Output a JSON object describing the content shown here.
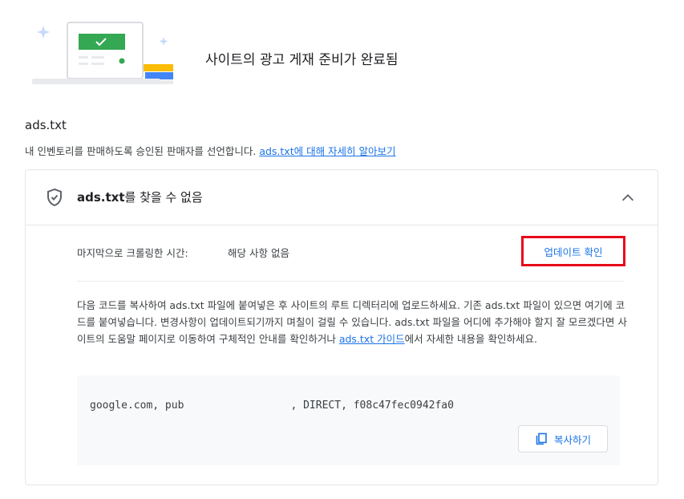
{
  "hero": {
    "title": "사이트의 광고 게재 준비가 완료됨"
  },
  "section": {
    "title": "ads.txt",
    "description": "내 인벤토리를 판매하도록 승인된 판매자를 선언합니다.",
    "learn_more_link": "ads.txt에 대해 자세히 알아보기"
  },
  "card": {
    "status_name": "ads.txt",
    "status_suffix": "를 찾을 수 없음",
    "crawl_label": "마지막으로 크롤링한 시간:",
    "crawl_value": "해당 사항 없음",
    "check_update_label": "업데이트 확인",
    "instructions_text": "다음 코드를 복사하여 ads.txt 파일에 붙여넣은 후 사이트의 루트 디렉터리에 업로드하세요. 기존 ads.txt 파일이 있으면 여기에 코드를 붙여넣습니다. 변경사항이 업데이트되기까지 며칠이 걸릴 수 있습니다. ads.txt 파일을 어디에 추가해야 할지 잘 모르겠다면 사이트의 도움말 페이지로 이동하여 구체적인 안내를 확인하거나 ",
    "guide_link": "ads.txt 가이드",
    "instructions_tail": "에서 자세한 내용을 확인하세요.",
    "code_line": "google.com, pub                 , DIRECT, f08c47fec0942fa0",
    "copy_label": "복사하기"
  },
  "icons": {
    "status": "shield-check-icon",
    "collapse": "chevron-up-icon",
    "copy": "copy-icon"
  },
  "colors": {
    "accent": "#1a73e8",
    "highlight_border": "#e8091b",
    "hero_green": "#34a853",
    "hero_blue": "#4285f4",
    "hero_yellow": "#fbbc04"
  }
}
